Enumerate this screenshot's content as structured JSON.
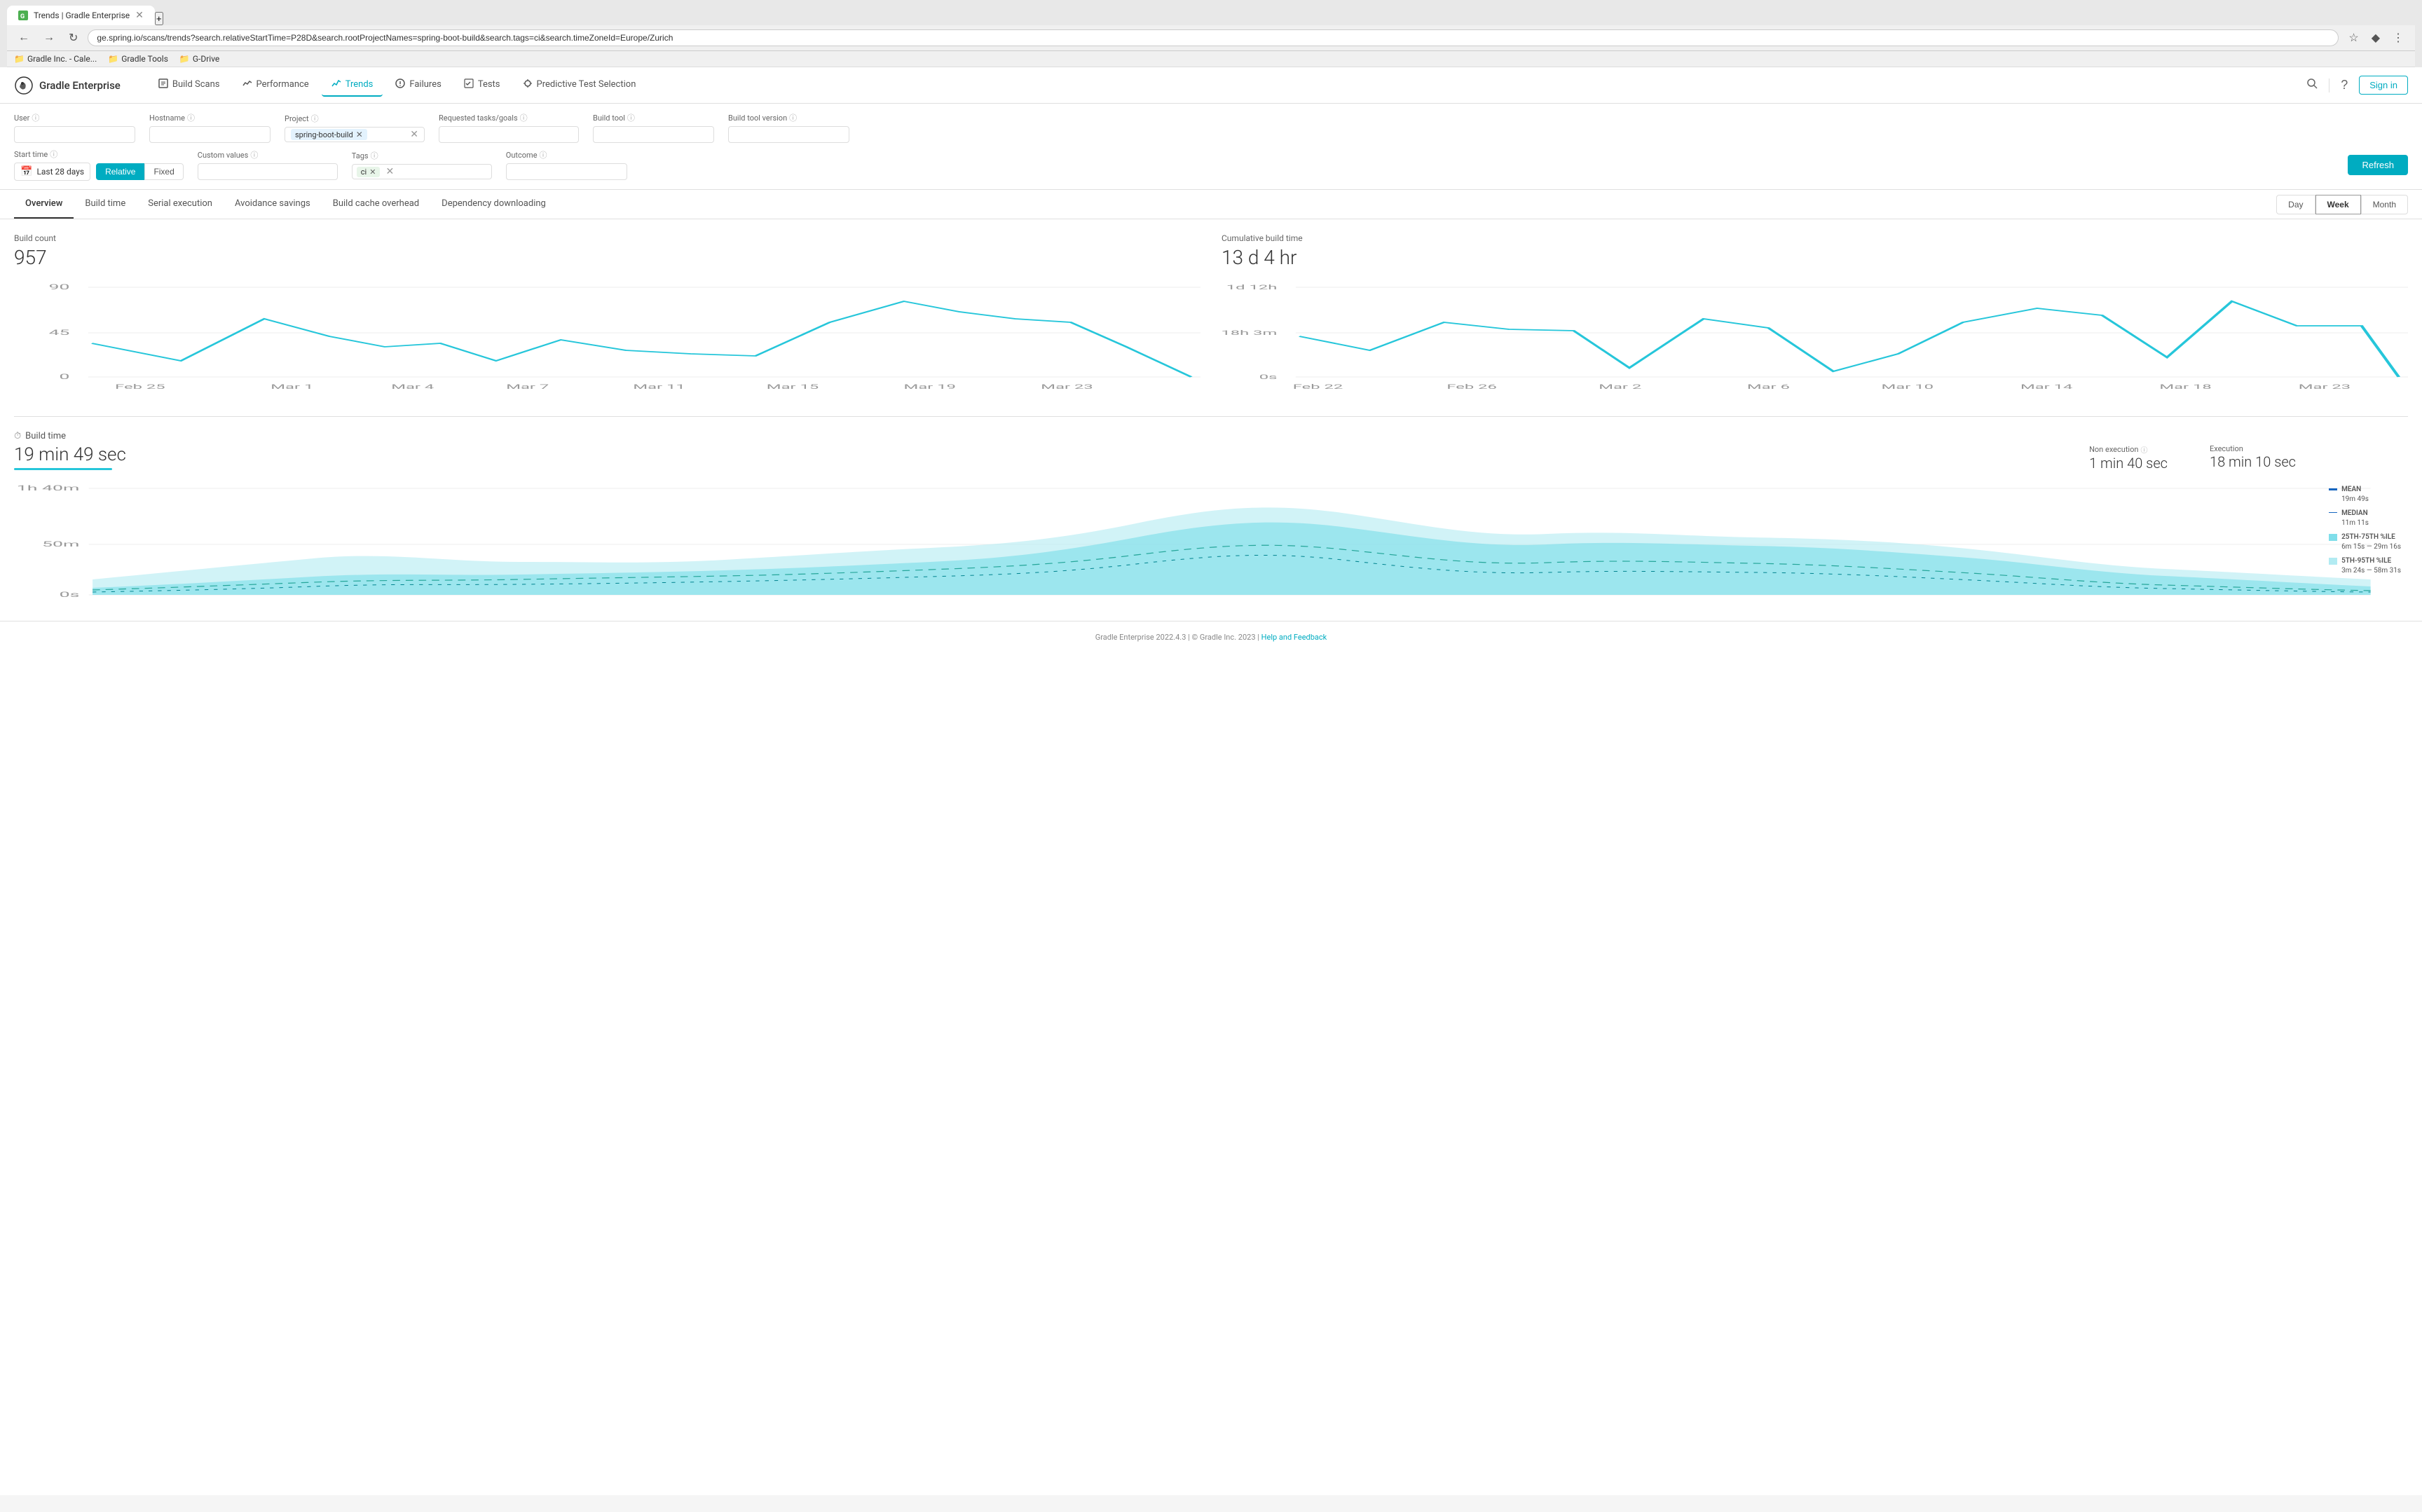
{
  "browser": {
    "tab_title": "Trends | Gradle Enterprise",
    "url": "ge.spring.io/scans/trends?search.relativeStartTime=P28D&search.rootProjectNames=spring-boot-build&search.tags=ci&search.timeZoneId=Europe/Zurich",
    "bookmarks": [
      {
        "label": "Gradle Inc. - Cale..."
      },
      {
        "label": "Gradle Tools"
      },
      {
        "label": "G-Drive"
      }
    ]
  },
  "app": {
    "logo_text": "Gradle Enterprise"
  },
  "nav": {
    "links": [
      {
        "id": "build-scans",
        "label": "Build Scans",
        "active": false
      },
      {
        "id": "performance",
        "label": "Performance",
        "active": false
      },
      {
        "id": "trends",
        "label": "Trends",
        "active": true
      },
      {
        "id": "failures",
        "label": "Failures",
        "active": false
      },
      {
        "id": "tests",
        "label": "Tests",
        "active": false
      },
      {
        "id": "predictive",
        "label": "Predictive Test Selection",
        "active": false
      }
    ],
    "sign_in": "Sign in"
  },
  "filters": {
    "user_label": "User",
    "hostname_label": "Hostname",
    "project_label": "Project",
    "project_tag": "spring-boot-build",
    "requested_tasks_label": "Requested tasks/goals",
    "build_tool_label": "Build tool",
    "build_tool_version_label": "Build tool version",
    "start_time_label": "Start time",
    "date_range": "Last 28 days",
    "relative_label": "Relative",
    "fixed_label": "Fixed",
    "custom_values_label": "Custom values",
    "tags_label": "Tags",
    "tag_value": "ci",
    "outcome_label": "Outcome",
    "refresh_label": "Refresh"
  },
  "sub_tabs": {
    "tabs": [
      {
        "id": "overview",
        "label": "Overview",
        "active": true
      },
      {
        "id": "build-time",
        "label": "Build time",
        "active": false
      },
      {
        "id": "serial-execution",
        "label": "Serial execution",
        "active": false
      },
      {
        "id": "avoidance-savings",
        "label": "Avoidance savings",
        "active": false
      },
      {
        "id": "build-cache-overhead",
        "label": "Build cache overhead",
        "active": false
      },
      {
        "id": "dependency-downloading",
        "label": "Dependency downloading",
        "active": false
      }
    ],
    "time_buttons": [
      {
        "id": "day",
        "label": "Day",
        "active": false
      },
      {
        "id": "week",
        "label": "Week",
        "active": true
      },
      {
        "id": "month",
        "label": "Month",
        "active": false
      }
    ]
  },
  "build_count": {
    "title": "Build count",
    "value": "957",
    "y_max": "90",
    "y_mid": "45",
    "y_min": "0",
    "x_labels": [
      "Feb 25",
      "Mar 1",
      "Mar 4",
      "Mar 7",
      "Mar 11",
      "Mar 15",
      "Mar 19",
      "Mar 23"
    ]
  },
  "cumulative_build_time": {
    "title": "Cumulative build time",
    "value": "13 d 4 hr",
    "y_max": "1d 12h",
    "y_mid": "18h 3m",
    "y_min": "0s",
    "x_labels": [
      "Feb 22",
      "Feb 26",
      "Mar 2",
      "Mar 6",
      "Mar 10",
      "Mar 14",
      "Mar 18",
      "Mar 23"
    ]
  },
  "build_time": {
    "section_title": "Build time",
    "value": "19 min 49 sec",
    "non_execution_label": "Non execution",
    "non_execution_value": "1 min 40 sec",
    "execution_label": "Execution",
    "execution_value": "18 min 10 sec",
    "y_max": "1h 40m",
    "y_mid": "50m",
    "y_min": "0s",
    "legend": [
      {
        "id": "mean",
        "label": "MEAN",
        "value": "19m 49s",
        "color": "#1e88e5"
      },
      {
        "id": "median",
        "label": "MEDIAN",
        "value": "11m 11s",
        "color": "#1e88e5"
      },
      {
        "id": "p25-p75",
        "label": "25TH-75TH %ILE",
        "value": "6m 15s — 29m 16s",
        "color": "#80deea"
      },
      {
        "id": "p5-p95",
        "label": "5TH-95TH %ILE",
        "value": "3m 24s — 58m 31s",
        "color": "#b2ebf2"
      }
    ]
  },
  "footer": {
    "text": "Gradle Enterprise 2022.4.3  |  © Gradle Inc. 2023  |  ",
    "link_label": "Help and Feedback",
    "link_url": "#"
  }
}
